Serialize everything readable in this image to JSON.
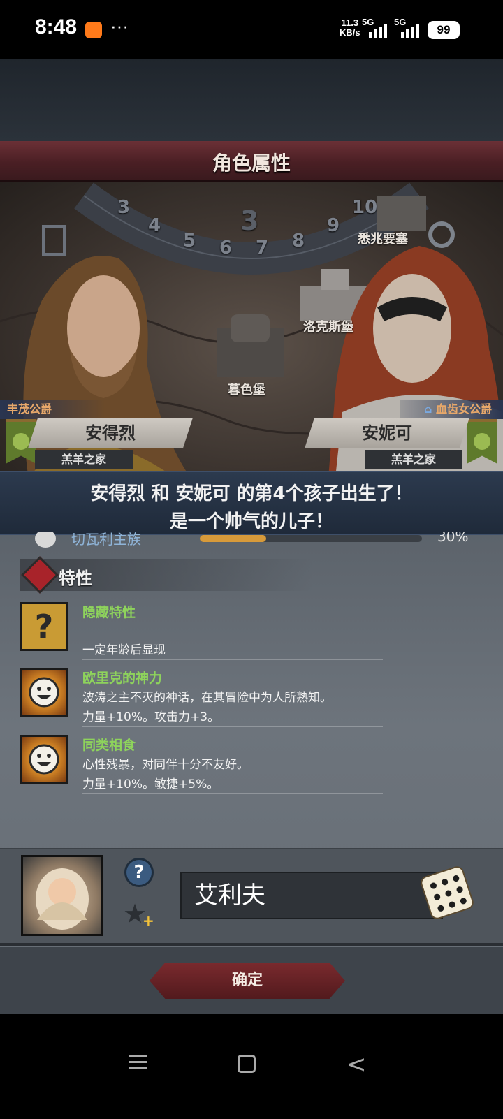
{
  "status_bar": {
    "time": "8:48",
    "more": "···",
    "speed": "11.3",
    "speed_unit": "KB/s",
    "net1": "5G",
    "net2": "5G",
    "battery": "99"
  },
  "screen": {
    "title": "角色属性"
  },
  "map": {
    "numbers": [
      "3",
      "4",
      "5",
      "6",
      "7",
      "8",
      "9",
      "10"
    ],
    "locations": {
      "fortress": "悉兆要塞",
      "castle": "洛克斯堡",
      "dusk": "暮色堡"
    }
  },
  "father": {
    "title": "丰茂公爵",
    "name": "安得烈",
    "house": "羔羊之家"
  },
  "mother": {
    "title": "血齿女公爵",
    "name": "安妮可",
    "house": "羔羊之家"
  },
  "message": {
    "line1": "安得烈 和 安妮可 的第4个孩子出生了！",
    "line2": "是一个帅气的儿子！"
  },
  "clan": {
    "name": "切瓦利主族",
    "percent": "30%",
    "fill": 0.3
  },
  "traits": {
    "header": "特性",
    "items": [
      {
        "icon": "question-icon",
        "name": "隐藏特性",
        "desc1": "",
        "desc2": "一定年龄后显现"
      },
      {
        "icon": "smile-icon",
        "name": "欧里克的神力",
        "desc1": "波涛之主不灭的神话，在其冒险中为人所熟知。",
        "desc2": "力量+10%。攻击力+3。"
      },
      {
        "icon": "smile-icon",
        "name": "同类相食",
        "desc1": "心性残暴，对同伴十分不友好。",
        "desc2": "力量+10%。敏捷+5%。"
      }
    ]
  },
  "child": {
    "name_value": "艾利夫",
    "question": "?",
    "star_plus": "+"
  },
  "buttons": {
    "confirm": "确定"
  },
  "nav": {
    "back": "<"
  },
  "colors": {
    "trait_name": "#8ed35c",
    "banner": "#6b3036",
    "confirm": "#7a2a2e"
  }
}
